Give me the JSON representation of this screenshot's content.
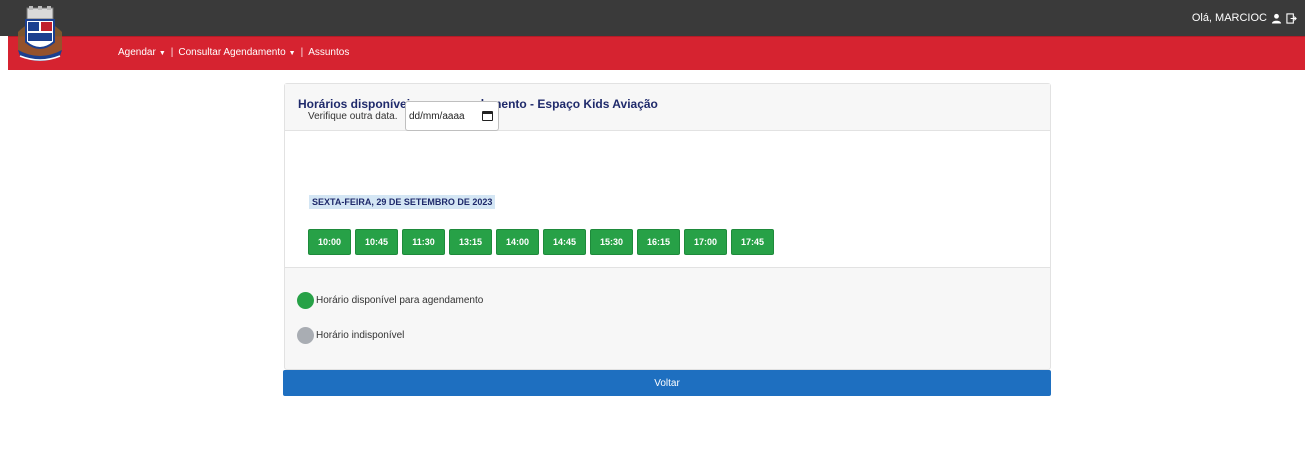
{
  "header": {
    "greeting": "Olá, MARCIOC",
    "user_icon": "user-icon",
    "logout_icon": "logout-icon"
  },
  "nav": {
    "items": [
      {
        "label": "Agendar",
        "dropdown": true
      },
      {
        "label": "Consultar Agendamento",
        "dropdown": true
      },
      {
        "label": "Assuntos",
        "dropdown": false
      }
    ],
    "separator": "|"
  },
  "card": {
    "title": "Horários disponíveis para agendamento - Espaço Kids Aviação",
    "date_label": "Verifique outra data.",
    "date_placeholder": "dd/mm/aaaa",
    "day_heading": "SEXTA-FEIRA, 29 DE SETEMBRO DE 2023",
    "slots": [
      "10:00",
      "10:45",
      "11:30",
      "13:15",
      "14:00",
      "14:45",
      "15:30",
      "16:15",
      "17:00",
      "17:45"
    ]
  },
  "legend": {
    "available": {
      "label": "Horário disponível para agendamento",
      "color": "#27a147"
    },
    "unavailable": {
      "label": "Horário indisponível",
      "color": "#a9adb3"
    }
  },
  "actions": {
    "back_label": "Voltar"
  },
  "colors": {
    "topbar": "#3a3a3a",
    "redbar": "#d62330",
    "slot_green": "#27a147",
    "primary_blue": "#1e6fc0",
    "title_navy": "#1f2a6b"
  }
}
